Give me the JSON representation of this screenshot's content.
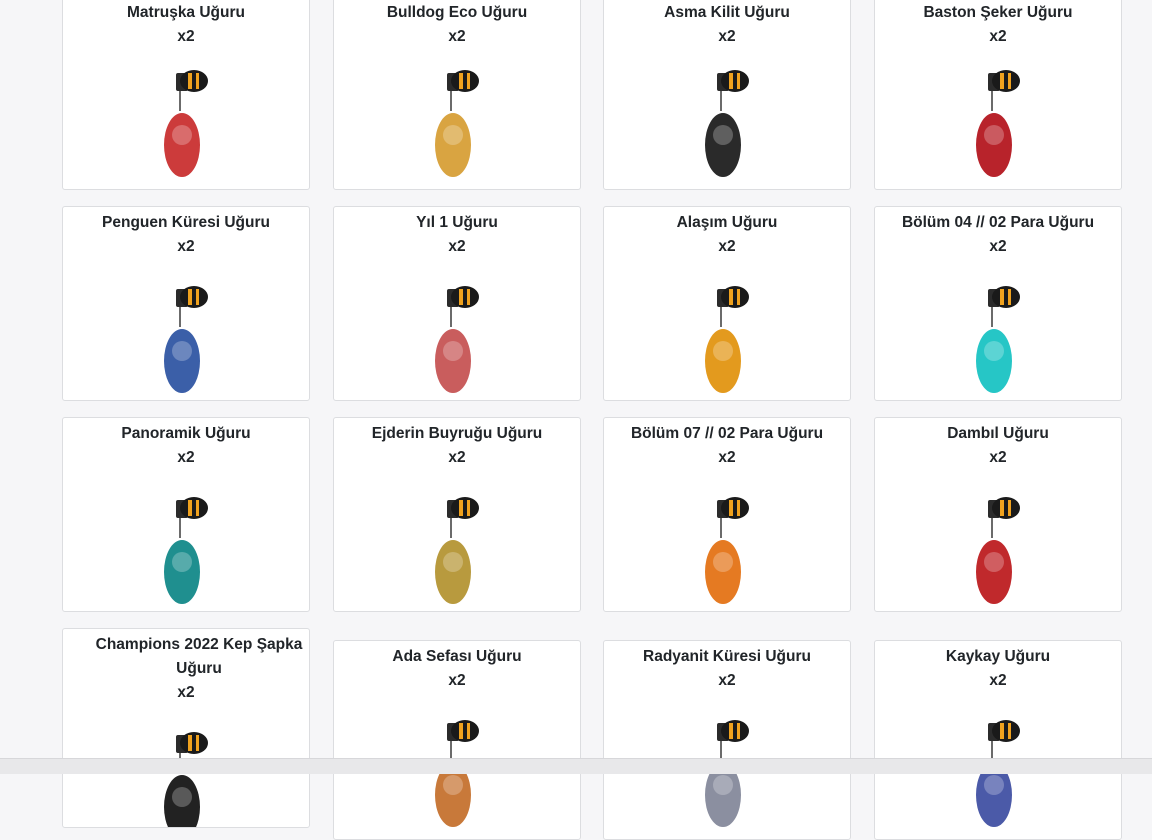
{
  "items": [
    {
      "name": "Matruşka Uğuru",
      "qty": "x2",
      "icon": "matryoshka-charm-icon",
      "color": "#cc3b3b"
    },
    {
      "name": "Bulldog Eco Uğuru",
      "qty": "x2",
      "icon": "bulldog-dollar-charm-icon",
      "color": "#d9a441"
    },
    {
      "name": "Asma Kilit Uğuru",
      "qty": "x2",
      "icon": "padlock-charm-icon",
      "color": "#2a2a2a"
    },
    {
      "name": "Baston Şeker Uğuru",
      "qty": "x2",
      "icon": "candy-cane-charm-icon",
      "color": "#b8232b"
    },
    {
      "name": "Penguen Küresi Uğuru",
      "qty": "x2",
      "icon": "penguin-globe-charm-icon",
      "color": "#3b5fa8"
    },
    {
      "name": "Yıl 1 Uğuru",
      "qty": "x2",
      "icon": "cake-slice-charm-icon",
      "color": "#c95d5d"
    },
    {
      "name": "Alaşım Uğuru",
      "qty": "x2",
      "icon": "alloy-robot-charm-icon",
      "color": "#e39a1e"
    },
    {
      "name": "Bölüm 04 // 02 Para Uğuru",
      "qty": "x2",
      "icon": "ep4-coin-charm-icon",
      "color": "#26c6c6"
    },
    {
      "name": "Panoramik Uğuru",
      "qty": "x2",
      "icon": "surfboard-charm-icon",
      "color": "#1f8f8f"
    },
    {
      "name": "Ejderin Buyruğu Uğuru",
      "qty": "x2",
      "icon": "dragon-charm-icon",
      "color": "#b89a3e"
    },
    {
      "name": "Bölüm 07 // 02 Para Uğuru",
      "qty": "x2",
      "icon": "ep7-coin-charm-icon",
      "color": "#e57a22"
    },
    {
      "name": "Dambıl Uğuru",
      "qty": "x2",
      "icon": "kettlebell-charm-icon",
      "color": "#c0292c"
    },
    {
      "name": "Champions 2022 Kep Şapka Uğuru",
      "qty": "x2",
      "icon": "champions-cap-charm-icon",
      "color": "#222222"
    },
    {
      "name": "Ada Sefası Uğuru",
      "qty": "x2",
      "icon": "island-charm-icon",
      "color": "#c8793a"
    },
    {
      "name": "Radyanit Küresi Uğuru",
      "qty": "x2",
      "icon": "radianite-globe-charm-icon",
      "color": "#8b8fa0"
    },
    {
      "name": "Kaykay Uğuru",
      "qty": "x2",
      "icon": "skateboard-charm-icon",
      "color": "#4b5aa8"
    }
  ]
}
